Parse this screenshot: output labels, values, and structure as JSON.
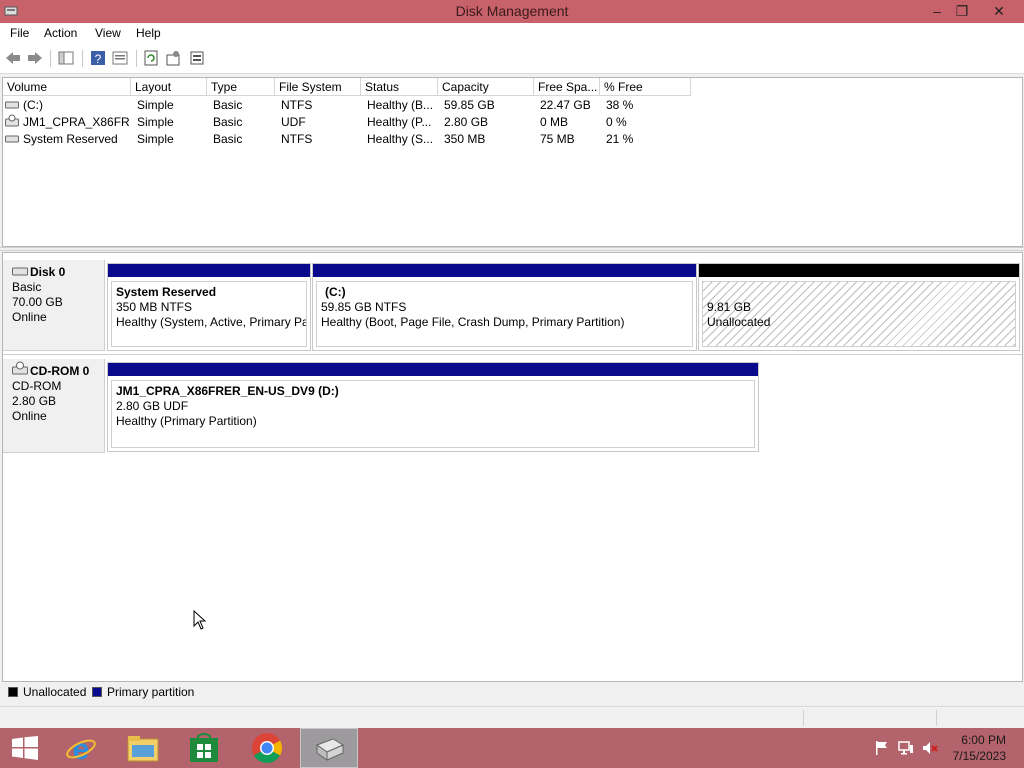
{
  "window": {
    "title": "Disk Management"
  },
  "menu": [
    "File",
    "Action",
    "View",
    "Help"
  ],
  "toolbar": [
    "back-icon",
    "forward-icon",
    "console-tree-icon",
    "help-icon",
    "properties-icon",
    "refresh-icon",
    "settings-icon",
    "rescan-icon"
  ],
  "volumes": {
    "columns": [
      "Volume",
      "Layout",
      "Type",
      "File System",
      "Status",
      "Capacity",
      "Free Spa...",
      "% Free"
    ],
    "rows": [
      {
        "icon": "drive-icon",
        "cells": [
          "(C:)",
          "Simple",
          "Basic",
          "NTFS",
          "Healthy (B...",
          "59.85 GB",
          "22.47 GB",
          "38 %"
        ]
      },
      {
        "icon": "cdrom-icon",
        "cells": [
          "JM1_CPRA_X86FR...",
          "Simple",
          "Basic",
          "UDF",
          "Healthy (P...",
          "2.80 GB",
          "0 MB",
          "0 %"
        ]
      },
      {
        "icon": "drive-icon",
        "cells": [
          "System Reserved",
          "Simple",
          "Basic",
          "NTFS",
          "Healthy (S...",
          "350 MB",
          "75 MB",
          "21 %"
        ]
      }
    ]
  },
  "disks": [
    {
      "name": "Disk 0",
      "type": "Basic",
      "size": "70.00 GB",
      "status": "Online",
      "partitions": [
        {
          "title": "System Reserved",
          "line2": "350 MB NTFS",
          "line3": "Healthy (System, Active, Primary Pa",
          "kind": "primary"
        },
        {
          "title": "(C:)",
          "line2": "59.85 GB NTFS",
          "line3": "Healthy (Boot, Page File, Crash Dump, Primary Partition)",
          "kind": "primary"
        },
        {
          "title": "",
          "line2": "9.81 GB",
          "line3": "Unallocated",
          "kind": "unallocated"
        }
      ]
    },
    {
      "name": "CD-ROM 0",
      "type": "CD-ROM",
      "size": "2.80 GB",
      "status": "Online",
      "partitions": [
        {
          "title": "JM1_CPRA_X86FRER_EN-US_DV9  (D:)",
          "line2": "2.80 GB UDF",
          "line3": "Healthy (Primary Partition)",
          "kind": "primary"
        }
      ]
    }
  ],
  "legend": [
    {
      "label": "Unallocated",
      "color": "#000000"
    },
    {
      "label": "Primary partition",
      "color": "#0a0a8c"
    }
  ],
  "colors": {
    "primary": "#0a0a8c",
    "unallocated": "#000000",
    "titlebar": "#c8626a",
    "taskbar": "#b3636b"
  },
  "taskbar": {
    "apps": [
      "windows-start-icon",
      "internet-explorer-icon",
      "file-explorer-icon",
      "windows-store-icon",
      "chrome-icon",
      "disk-management-icon"
    ],
    "time": "6:00 PM",
    "date": "7/15/2023"
  }
}
